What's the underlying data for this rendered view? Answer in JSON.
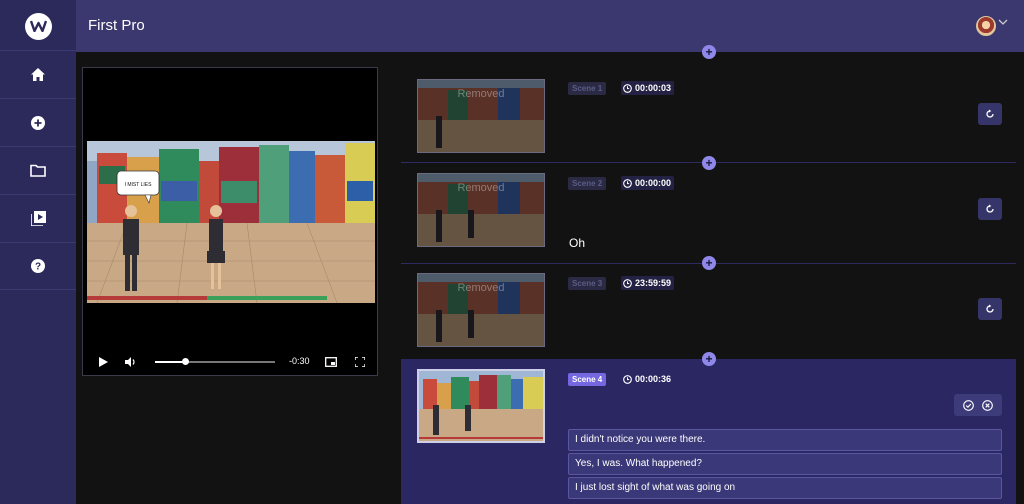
{
  "app": {
    "title": "First Pro"
  },
  "sidebar": {
    "items": [
      {
        "name": "home",
        "icon": "home-icon"
      },
      {
        "name": "create",
        "icon": "plus-circle-icon"
      },
      {
        "name": "folder",
        "icon": "folder-icon"
      },
      {
        "name": "media-library",
        "icon": "video-library-icon"
      },
      {
        "name": "help",
        "icon": "help-icon"
      }
    ]
  },
  "player": {
    "time_remaining": "-0:30",
    "bubble_text": "I MIST LIES",
    "progress": 0.25
  },
  "scenes": [
    {
      "label": "Scene 1",
      "time": "00:00:03",
      "thumb_text": "Removed",
      "text": "",
      "active": false
    },
    {
      "label": "Scene 2",
      "time": "00:00:00",
      "thumb_text": "Removed",
      "text": "Oh",
      "active": false
    },
    {
      "label": "Scene 3",
      "time": "23:59:59",
      "thumb_text": "Removed",
      "text": "",
      "active": false
    },
    {
      "label": "Scene 4",
      "time": "00:00:36",
      "thumb_text": "",
      "text": "",
      "active": true
    }
  ],
  "scene4_lines": [
    "I didn't notice you were there.",
    "Yes, I was. What happened?",
    "I just lost sight of what was going on"
  ],
  "colors": {
    "sidebar": "#2c2a5a",
    "header": "#3b376f",
    "accent": "#7467e0",
    "active_bg": "#2a2763"
  }
}
